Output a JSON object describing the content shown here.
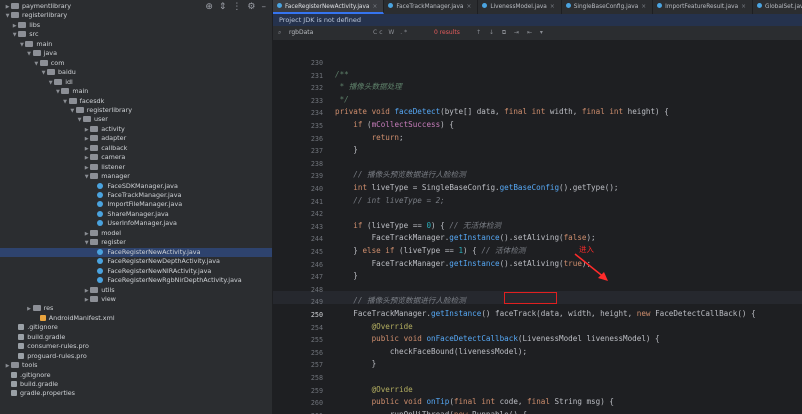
{
  "tree": {
    "toolbar_icons": [
      "crosshair-icon",
      "collapse-icon",
      "more-icon",
      "settings-icon",
      "minimize-icon"
    ],
    "rows": [
      {
        "label": "paymentlibrary",
        "depth": 0,
        "arrow": ">",
        "icon": "folder",
        "sel": false
      },
      {
        "label": "registerlibrary",
        "depth": 0,
        "arrow": "v",
        "icon": "folder",
        "sel": false
      },
      {
        "label": "libs",
        "depth": 1,
        "arrow": ">",
        "icon": "folder",
        "sel": false
      },
      {
        "label": "src",
        "depth": 1,
        "arrow": "v",
        "icon": "folder",
        "sel": false
      },
      {
        "label": "main",
        "depth": 2,
        "arrow": "v",
        "icon": "folder",
        "sel": false
      },
      {
        "label": "java",
        "depth": 3,
        "arrow": "v",
        "icon": "folder",
        "sel": false
      },
      {
        "label": "com",
        "depth": 4,
        "arrow": "v",
        "icon": "folder",
        "sel": false
      },
      {
        "label": "baidu",
        "depth": 5,
        "arrow": "v",
        "icon": "folder",
        "sel": false
      },
      {
        "label": "idl",
        "depth": 6,
        "arrow": "v",
        "icon": "folder",
        "sel": false
      },
      {
        "label": "main",
        "depth": 7,
        "arrow": "v",
        "icon": "folder",
        "sel": false
      },
      {
        "label": "facesdk",
        "depth": 8,
        "arrow": "v",
        "icon": "folder",
        "sel": false
      },
      {
        "label": "registerlibrary",
        "depth": 9,
        "arrow": "v",
        "icon": "folder",
        "sel": false
      },
      {
        "label": "user",
        "depth": 10,
        "arrow": "v",
        "icon": "folder",
        "sel": false
      },
      {
        "label": "activity",
        "depth": 11,
        "arrow": ">",
        "icon": "folder",
        "sel": false
      },
      {
        "label": "adapter",
        "depth": 11,
        "arrow": ">",
        "icon": "folder",
        "sel": false
      },
      {
        "label": "callback",
        "depth": 11,
        "arrow": ">",
        "icon": "folder",
        "sel": false
      },
      {
        "label": "camera",
        "depth": 11,
        "arrow": ">",
        "icon": "folder",
        "sel": false
      },
      {
        "label": "listener",
        "depth": 11,
        "arrow": ">",
        "icon": "folder",
        "sel": false
      },
      {
        "label": "manager",
        "depth": 11,
        "arrow": "v",
        "icon": "folder",
        "sel": false
      },
      {
        "label": "FaceSDKManager.java",
        "depth": 12,
        "arrow": "",
        "icon": "java",
        "sel": false
      },
      {
        "label": "FaceTrackManager.java",
        "depth": 12,
        "arrow": "",
        "icon": "java",
        "sel": false
      },
      {
        "label": "ImportFileManager.java",
        "depth": 12,
        "arrow": "",
        "icon": "java",
        "sel": false
      },
      {
        "label": "ShareManager.java",
        "depth": 12,
        "arrow": "",
        "icon": "java",
        "sel": false
      },
      {
        "label": "UserInfoManager.java",
        "depth": 12,
        "arrow": "",
        "icon": "java",
        "sel": false
      },
      {
        "label": "model",
        "depth": 11,
        "arrow": ">",
        "icon": "folder",
        "sel": false
      },
      {
        "label": "register",
        "depth": 11,
        "arrow": "v",
        "icon": "folder",
        "sel": false
      },
      {
        "label": "FaceRegisterNewActivity.java",
        "depth": 12,
        "arrow": "",
        "icon": "java",
        "sel": true
      },
      {
        "label": "FaceRegisterNewDepthActivity.java",
        "depth": 12,
        "arrow": "",
        "icon": "java",
        "sel": false
      },
      {
        "label": "FaceRegisterNewNIRActivity.java",
        "depth": 12,
        "arrow": "",
        "icon": "java",
        "sel": false
      },
      {
        "label": "FaceRegisterNewRgbNirDepthActivity.java",
        "depth": 12,
        "arrow": "",
        "icon": "java",
        "sel": false
      },
      {
        "label": "utils",
        "depth": 11,
        "arrow": ">",
        "icon": "folder",
        "sel": false
      },
      {
        "label": "view",
        "depth": 11,
        "arrow": ">",
        "icon": "folder",
        "sel": false
      },
      {
        "label": "res",
        "depth": 3,
        "arrow": ">",
        "icon": "folder",
        "sel": false
      },
      {
        "label": "AndroidManifest.xml",
        "depth": 4,
        "arrow": "",
        "icon": "xml",
        "sel": false
      },
      {
        "label": ".gitignore",
        "depth": 1,
        "arrow": "",
        "icon": "file",
        "sel": false
      },
      {
        "label": "build.gradle",
        "depth": 1,
        "arrow": "",
        "icon": "file",
        "sel": false
      },
      {
        "label": "consumer-rules.pro",
        "depth": 1,
        "arrow": "",
        "icon": "file",
        "sel": false
      },
      {
        "label": "proguard-rules.pro",
        "depth": 1,
        "arrow": "",
        "icon": "file",
        "sel": false
      },
      {
        "label": "tools",
        "depth": 0,
        "arrow": ">",
        "icon": "folder",
        "sel": false
      },
      {
        "label": ".gitignore",
        "depth": 0,
        "arrow": "",
        "icon": "file",
        "sel": false
      },
      {
        "label": "build.gradle",
        "depth": 0,
        "arrow": "",
        "icon": "file",
        "sel": false
      },
      {
        "label": "gradle.properties",
        "depth": 0,
        "arrow": "",
        "icon": "file",
        "sel": false
      }
    ]
  },
  "tabs": [
    {
      "label": "FaceRegisterNewActivity.java",
      "active": true
    },
    {
      "label": "FaceTrackManager.java",
      "active": false
    },
    {
      "label": "LivenessModel.java",
      "active": false
    },
    {
      "label": "SingleBaseConfig.java",
      "active": false
    },
    {
      "label": "ImportFeatureResult.java",
      "active": false
    },
    {
      "label": "GlobalSet.java",
      "active": false
    },
    {
      "label": "FaceRgbN",
      "active": false
    }
  ],
  "notice": "Project JDK is not defined",
  "findbar": {
    "query": "rgbData",
    "options": "Cc W .*",
    "results": "0 results",
    "nav": "↑ ↓ ⧉ ⇥ ⇤ ▾"
  },
  "gutter": [
    "230",
    "231",
    "232",
    "233",
    "234",
    "235",
    "236",
    "237",
    "238",
    "239",
    "240",
    "241",
    "242",
    "243",
    "244",
    "245",
    "246",
    "247",
    "248",
    "249",
    "250",
    "254",
    "255",
    "256",
    "257",
    "258",
    "259",
    "260",
    "261"
  ],
  "current_line": "250",
  "code": [
    [],
    [
      [
        "dc",
        "/**"
      ]
    ],
    [
      [
        "dc",
        " * 播像头数据处理"
      ]
    ],
    [
      [
        "dc",
        " */"
      ]
    ],
    [
      [
        "k",
        "private void "
      ],
      [
        "f",
        "faceDetect"
      ],
      [
        "t",
        "(byte[] data, "
      ],
      [
        "k",
        "final int "
      ],
      [
        "t",
        "width, "
      ],
      [
        "k",
        "final int "
      ],
      [
        "t",
        "height) {"
      ]
    ],
    [
      [
        "t",
        "    "
      ],
      [
        "k",
        "if "
      ],
      [
        "t",
        "("
      ],
      [
        "p",
        "mCollectSuccess"
      ],
      [
        "t",
        ") {"
      ]
    ],
    [
      [
        "t",
        "        "
      ],
      [
        "k",
        "return"
      ],
      [
        "t",
        ";"
      ]
    ],
    [
      [
        "t",
        "    }"
      ]
    ],
    [],
    [
      [
        "t",
        "    "
      ],
      [
        "c",
        "// 播像头预览数据进行人脸检测"
      ]
    ],
    [
      [
        "t",
        "    "
      ],
      [
        "k",
        "int "
      ],
      [
        "t",
        "liveType = SingleBaseConfig."
      ],
      [
        "f",
        "getBaseConfig"
      ],
      [
        "t",
        "().getType();"
      ]
    ],
    [
      [
        "t",
        "    "
      ],
      [
        "c",
        "// int liveType = 2;"
      ]
    ],
    [],
    [
      [
        "t",
        "    "
      ],
      [
        "k",
        "if "
      ],
      [
        "t",
        "(liveType == "
      ],
      [
        "n",
        "0"
      ],
      [
        "t",
        ") { "
      ],
      [
        "c",
        "// 无活体检测"
      ]
    ],
    [
      [
        "t",
        "        FaceTrackManager."
      ],
      [
        "f",
        "getInstance"
      ],
      [
        "t",
        "().setAliving("
      ],
      [
        "k",
        "false"
      ],
      [
        "t",
        ");"
      ]
    ],
    [
      [
        "t",
        "    } "
      ],
      [
        "k",
        "else if "
      ],
      [
        "t",
        "(liveType == "
      ],
      [
        "n",
        "1"
      ],
      [
        "t",
        ") { "
      ],
      [
        "c",
        "// 活体检测"
      ]
    ],
    [
      [
        "t",
        "        FaceTrackManager."
      ],
      [
        "f",
        "getInstance"
      ],
      [
        "t",
        "().setAliving("
      ],
      [
        "k",
        "true"
      ],
      [
        "t",
        ");"
      ]
    ],
    [
      [
        "t",
        "    }"
      ]
    ],
    [],
    [
      [
        "t",
        "    "
      ],
      [
        "c",
        "// 播像头预览数据进行人脸检测"
      ]
    ],
    [
      [
        "t",
        "    FaceTrackManager."
      ],
      [
        "f",
        "getInstance"
      ],
      [
        "t",
        "() faceTrack(data, width, height, "
      ],
      [
        "k",
        "new "
      ],
      [
        "t",
        "FaceDetectCallBack() {"
      ]
    ],
    [
      [
        "t",
        "        "
      ],
      [
        "a",
        "@Override"
      ]
    ],
    [
      [
        "t",
        "        "
      ],
      [
        "k",
        "public void "
      ],
      [
        "f",
        "onFaceDetectCallback"
      ],
      [
        "t",
        "(LivenessModel livenessModel) {"
      ]
    ],
    [
      [
        "t",
        "            checkFaceBound(livenessModel);"
      ]
    ],
    [
      [
        "t",
        "        }"
      ]
    ],
    [],
    [
      [
        "t",
        "        "
      ],
      [
        "a",
        "@Override"
      ]
    ],
    [
      [
        "t",
        "        "
      ],
      [
        "k",
        "public void "
      ],
      [
        "f",
        "onTip"
      ],
      [
        "t",
        "("
      ],
      [
        "k",
        "final int "
      ],
      [
        "t",
        "code, "
      ],
      [
        "k",
        "final "
      ],
      [
        "t",
        "String msg) {"
      ]
    ],
    [
      [
        "t",
        "            runOnUiThread("
      ],
      [
        "k",
        "new "
      ],
      [
        "t",
        "Runnable() {"
      ]
    ]
  ],
  "annotation": {
    "text": "进入",
    "highlighted": "faceTrack"
  }
}
